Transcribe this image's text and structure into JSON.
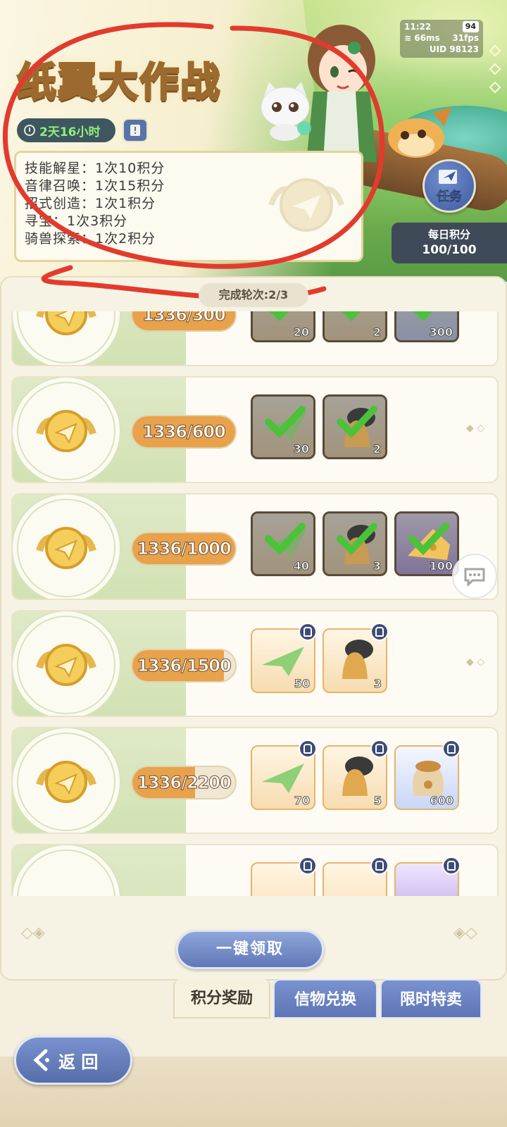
{
  "banner": {
    "title": "纸翼大作战",
    "timer": "2天16小时",
    "rules": [
      "技能解星：1次10积分",
      "音律召唤：1次15积分",
      "招式创造：1次1积分",
      "寻宝：1次3积分",
      "骑兽探索：1次2积分"
    ],
    "task_label": "任务",
    "daily_label": "每日积分",
    "daily_value": "100/100"
  },
  "status_bar": {
    "time": "11:22",
    "battery": "94",
    "ping": "66ms",
    "fps": "31fps",
    "uid": "UID 98123"
  },
  "panel": {
    "round_label": "完成轮次:2/3",
    "rows": [
      {
        "progress_text": "1336/300",
        "fill_fraction": 1.0,
        "items": [
          {
            "count": "20",
            "state": "claimed"
          },
          {
            "count": "2",
            "state": "claimed"
          },
          {
            "count": "300",
            "state": "claimed"
          }
        ]
      },
      {
        "progress_text": "1336/600",
        "fill_fraction": 1.0,
        "items": [
          {
            "count": "30",
            "state": "claimed"
          },
          {
            "count": "2",
            "state": "claimed"
          }
        ]
      },
      {
        "progress_text": "1336/1000",
        "fill_fraction": 1.0,
        "items": [
          {
            "count": "40",
            "state": "claimed"
          },
          {
            "count": "3",
            "state": "claimed"
          },
          {
            "count": "100",
            "state": "claimed"
          }
        ]
      },
      {
        "progress_text": "1336/1500",
        "fill_fraction": 0.89,
        "items": [
          {
            "count": "50",
            "state": "locked"
          },
          {
            "count": "3",
            "state": "locked"
          }
        ]
      },
      {
        "progress_text": "1336/2200",
        "fill_fraction": 0.61,
        "items": [
          {
            "count": "70",
            "state": "locked"
          },
          {
            "count": "5",
            "state": "locked"
          },
          {
            "count": "600",
            "state": "locked"
          }
        ]
      }
    ]
  },
  "actions": {
    "claim_all": "一键领取",
    "back": "返 回"
  },
  "tabs": [
    {
      "label": "积分奖励",
      "active": true
    },
    {
      "label": "信物兑换",
      "active": false
    },
    {
      "label": "限时特卖",
      "active": false
    }
  ],
  "colors": {
    "accent_blue": "#5f78b8",
    "progress_orange": "#e8a24c",
    "timer_green": "#8ff07a",
    "annotation_red": "#e23b2e"
  }
}
